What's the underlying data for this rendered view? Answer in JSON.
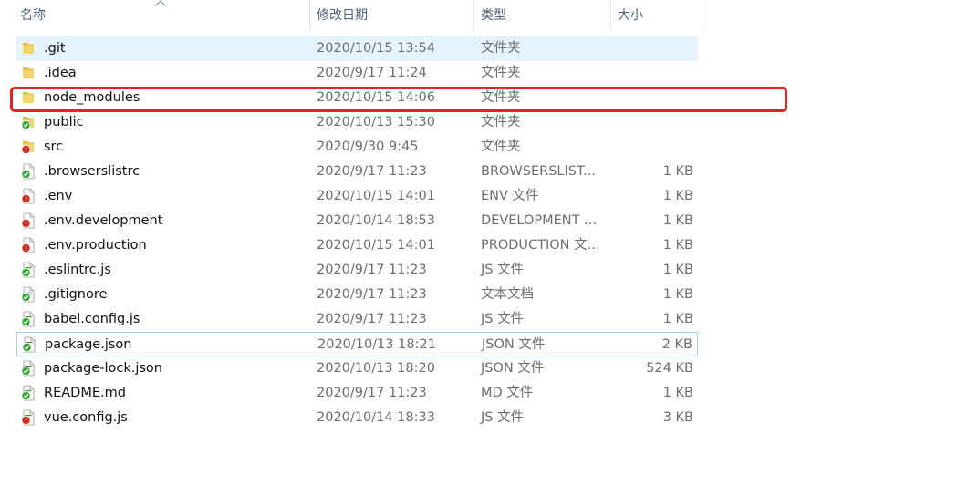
{
  "header": {
    "col_name": "名称",
    "col_date": "修改日期",
    "col_type": "类型",
    "col_size": "大小"
  },
  "files": [
    {
      "name": ".git",
      "date": "2020/10/15 13:54",
      "type": "文件夹",
      "size": "",
      "icon": "folder-icon",
      "state": "selected"
    },
    {
      "name": ".idea",
      "date": "2020/9/17 11:24",
      "type": "文件夹",
      "size": "",
      "icon": "folder-icon",
      "state": ""
    },
    {
      "name": "node_modules",
      "date": "2020/10/15 14:06",
      "type": "文件夹",
      "size": "",
      "icon": "folder-icon",
      "state": ""
    },
    {
      "name": "public",
      "date": "2020/10/13 15:30",
      "type": "文件夹",
      "size": "",
      "icon": "folder-git-clean-icon",
      "state": ""
    },
    {
      "name": "src",
      "date": "2020/9/30 9:45",
      "type": "文件夹",
      "size": "",
      "icon": "folder-git-modified-icon",
      "state": ""
    },
    {
      "name": ".browserslistrc",
      "date": "2020/9/17 11:23",
      "type": "BROWSERSLIST...",
      "size": "1 KB",
      "icon": "file-git-clean-icon",
      "state": ""
    },
    {
      "name": ".env",
      "date": "2020/10/15 14:01",
      "type": "ENV 文件",
      "size": "1 KB",
      "icon": "file-git-modified-icon",
      "state": ""
    },
    {
      "name": ".env.development",
      "date": "2020/10/14 18:53",
      "type": "DEVELOPMENT ...",
      "size": "1 KB",
      "icon": "file-git-modified-icon",
      "state": ""
    },
    {
      "name": ".env.production",
      "date": "2020/10/15 14:01",
      "type": "PRODUCTION 文...",
      "size": "1 KB",
      "icon": "file-git-modified-icon",
      "state": ""
    },
    {
      "name": ".eslintrc.js",
      "date": "2020/9/17 11:23",
      "type": "JS 文件",
      "size": "1 KB",
      "icon": "js-file-git-clean-icon",
      "state": ""
    },
    {
      "name": ".gitignore",
      "date": "2020/9/17 11:23",
      "type": "文本文档",
      "size": "1 KB",
      "icon": "text-file-git-clean-icon",
      "state": ""
    },
    {
      "name": "babel.config.js",
      "date": "2020/9/17 11:23",
      "type": "JS 文件",
      "size": "1 KB",
      "icon": "js-file-git-clean-icon",
      "state": ""
    },
    {
      "name": "package.json",
      "date": "2020/10/13 18:21",
      "type": "JSON 文件",
      "size": "2 KB",
      "icon": "json-file-git-clean-icon",
      "state": "focused"
    },
    {
      "name": "package-lock.json",
      "date": "2020/10/13 18:20",
      "type": "JSON 文件",
      "size": "524 KB",
      "icon": "json-file-git-clean-icon",
      "state": ""
    },
    {
      "name": "README.md",
      "date": "2020/9/17 11:23",
      "type": "MD 文件",
      "size": "1 KB",
      "icon": "md-file-git-clean-icon",
      "state": ""
    },
    {
      "name": "vue.config.js",
      "date": "2020/10/14 18:33",
      "type": "JS 文件",
      "size": "3 KB",
      "icon": "js-file-git-modified-icon",
      "state": ""
    }
  ],
  "colors": {
    "highlight_border": "#e52222",
    "selected_bg": "#e5f3ff",
    "git_clean": "#2fa62f",
    "git_modified": "#d42a1a",
    "folder": "#f5cf5e"
  }
}
